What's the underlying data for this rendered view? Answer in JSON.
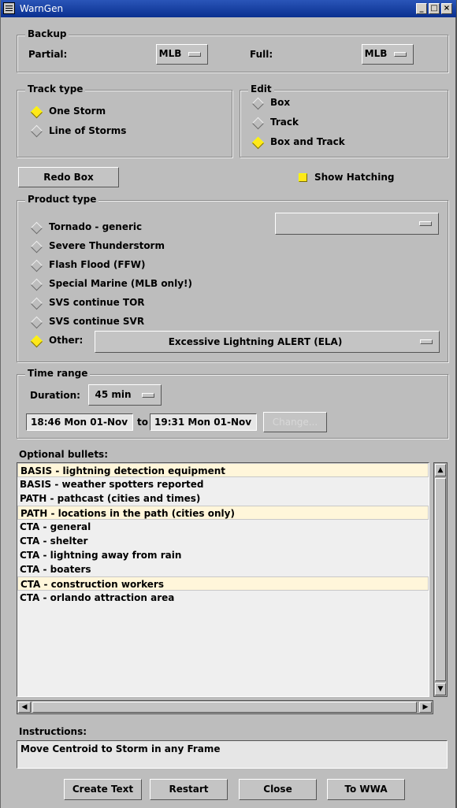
{
  "window": {
    "title": "WarnGen"
  },
  "backup": {
    "legend": "Backup",
    "partial_label": "Partial:",
    "partial_value": "MLB",
    "full_label": "Full:",
    "full_value": "MLB"
  },
  "track_type": {
    "legend": "Track type",
    "options": [
      {
        "label": "One Storm",
        "selected": true
      },
      {
        "label": "Line of Storms",
        "selected": false
      }
    ]
  },
  "edit": {
    "legend": "Edit",
    "options": [
      {
        "label": "Box",
        "selected": false
      },
      {
        "label": "Track",
        "selected": false
      },
      {
        "label": "Box and Track",
        "selected": true
      }
    ]
  },
  "redo_box_label": "Redo Box",
  "show_hatching": {
    "label": "Show Hatching",
    "checked": true
  },
  "product_type": {
    "legend": "Product type",
    "options": [
      {
        "label": "Tornado - generic",
        "selected": false
      },
      {
        "label": "Severe Thunderstorm",
        "selected": false
      },
      {
        "label": "Flash Flood (FFW)",
        "selected": false
      },
      {
        "label": "Special Marine  (MLB only!)",
        "selected": false
      },
      {
        "label": "SVS continue TOR",
        "selected": false
      },
      {
        "label": "SVS continue SVR",
        "selected": false
      },
      {
        "label": "Other:",
        "selected": true
      }
    ],
    "secondary_select": "",
    "other_select": "Excessive Lightning ALERT (ELA)"
  },
  "time_range": {
    "legend": "Time range",
    "duration_label": "Duration:",
    "duration_value": "45 min",
    "start": "18:46 Mon 01-Nov",
    "to_label": "to",
    "end": "19:31 Mon 01-Nov",
    "change_label": "Change..."
  },
  "bullets": {
    "label": "Optional bullets:",
    "items": [
      {
        "text": "BASIS - lightning detection equipment",
        "highlighted": true
      },
      {
        "text": "BASIS - weather spotters reported",
        "highlighted": false
      },
      {
        "text": "PATH - pathcast (cities and times)",
        "highlighted": false
      },
      {
        "text": "PATH - locations in the path (cities only)",
        "highlighted": true
      },
      {
        "text": "CTA - general",
        "highlighted": false
      },
      {
        "text": "CTA - shelter",
        "highlighted": false
      },
      {
        "text": "CTA - lightning away from rain",
        "highlighted": false
      },
      {
        "text": "CTA - boaters",
        "highlighted": false
      },
      {
        "text": "CTA - construction workers",
        "highlighted": true
      },
      {
        "text": "CTA - orlando attraction area",
        "highlighted": false
      }
    ]
  },
  "instructions": {
    "label": "Instructions:",
    "text": "Move Centroid to Storm in any Frame"
  },
  "buttons": {
    "create_text": "Create Text",
    "restart": "Restart",
    "close": "Close",
    "to_wwa": "To WWA"
  },
  "colors": {
    "titlebar": "#0a3090",
    "selected": "#ffe81a",
    "highlight_row": "#fff6da"
  }
}
